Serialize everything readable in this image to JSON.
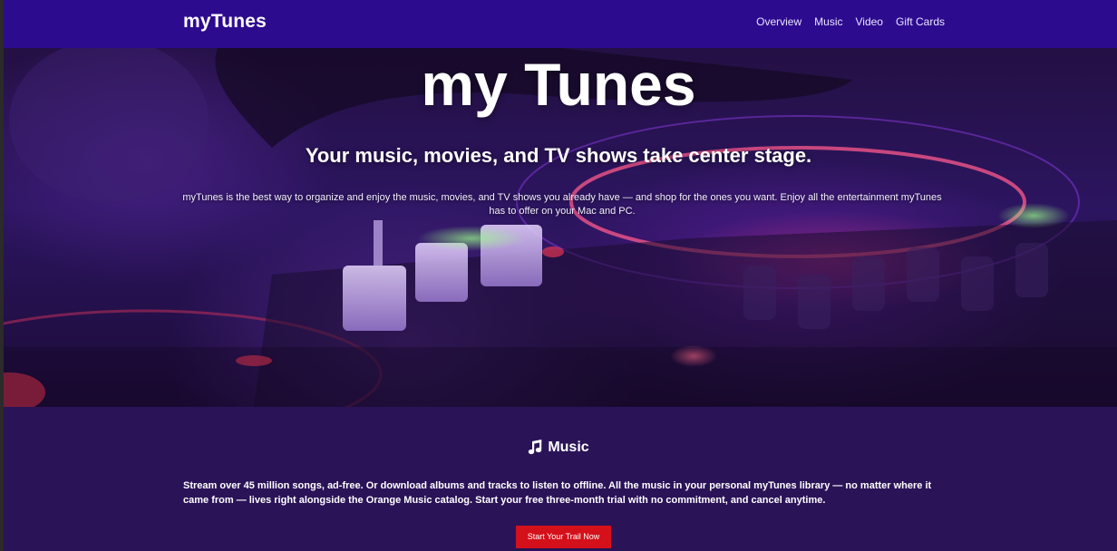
{
  "navbar": {
    "brand": "myTunes",
    "links": [
      "Overview",
      "Music",
      "Video",
      "Gift Cards"
    ]
  },
  "hero": {
    "title": "my Tunes",
    "subtitle": "Your music, movies, and TV shows take center stage.",
    "description": "myTunes is the best way to organize and enjoy the music, movies, and TV shows you already have — and shop for the ones you want. Enjoy all the entertainment myTunes has to offer on your Mac and PC."
  },
  "music": {
    "icon": "music-note-icon",
    "heading": "Music",
    "description": "Stream over 45 million songs, ad-free. Or download albums and tracks to listen to offline. All the music in your personal myTunes library — no matter where it came from — lives right alongside the Orange Music catalog. Start your free three-month trial with no commitment, and cancel anytime.",
    "cta_label": "Start Your Trail Now"
  },
  "colors": {
    "navbar_bg": "#2d0b8f",
    "section_bg": "#2b1358",
    "cta_bg": "#d4101a"
  }
}
